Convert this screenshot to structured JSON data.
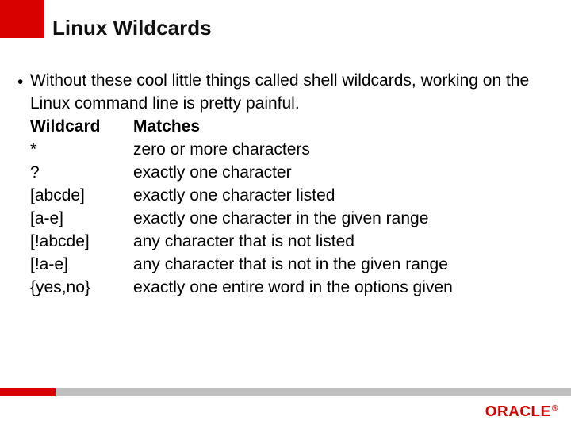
{
  "title": "Linux Wildcards",
  "bullet": "Without these cool little things called shell wildcards, working on the Linux command line is pretty painful.",
  "header": {
    "col1": "Wildcard",
    "col2": "Matches"
  },
  "rows": [
    {
      "w": "*",
      "m": "zero or more characters"
    },
    {
      "w": "?",
      "m": "exactly one character"
    },
    {
      "w": "[abcde]",
      "m": "exactly one character listed"
    },
    {
      "w": "[a-e]",
      "m": "exactly one character in the given range"
    },
    {
      "w": "[!abcde]",
      "m": "any character that is not listed"
    },
    {
      "w": "[!a-e]",
      "m": "any character that is not in the given range"
    },
    {
      "w": "{yes,no}",
      "m": "exactly one entire word in the options given"
    }
  ],
  "logo": "ORACLE"
}
